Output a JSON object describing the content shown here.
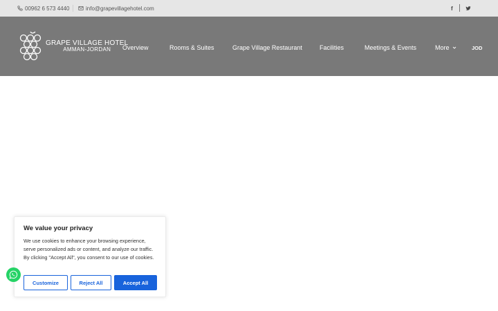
{
  "topbar": {
    "phone": "00962 6 573 4440",
    "email": "info@grapevillagehotel.com",
    "social": [
      "f",
      "t"
    ]
  },
  "logo": {
    "name": "GRAPE VILLAGE HOTEL",
    "location": "AMMAN-JORDAN",
    "icon": "grape-cluster-icon"
  },
  "nav": {
    "items": [
      "Overview",
      "Rooms & Suites",
      "Grape Village Restaurant",
      "Facilities",
      "Meetings & Events",
      "More"
    ],
    "currency": "JOD"
  },
  "cookie": {
    "title": "We value your privacy",
    "body": "We use cookies to enhance your browsing experience, serve personalized ads or content, and analyze our traffic. By clicking \"Accept All\", you consent to our use of cookies.",
    "customize": "Customize",
    "reject": "Reject All",
    "accept": "Accept All"
  },
  "colors": {
    "header_bg": "#797979",
    "topbar_bg": "#e6e6e6",
    "accent": "#1863dc",
    "whatsapp": "#25d366"
  }
}
